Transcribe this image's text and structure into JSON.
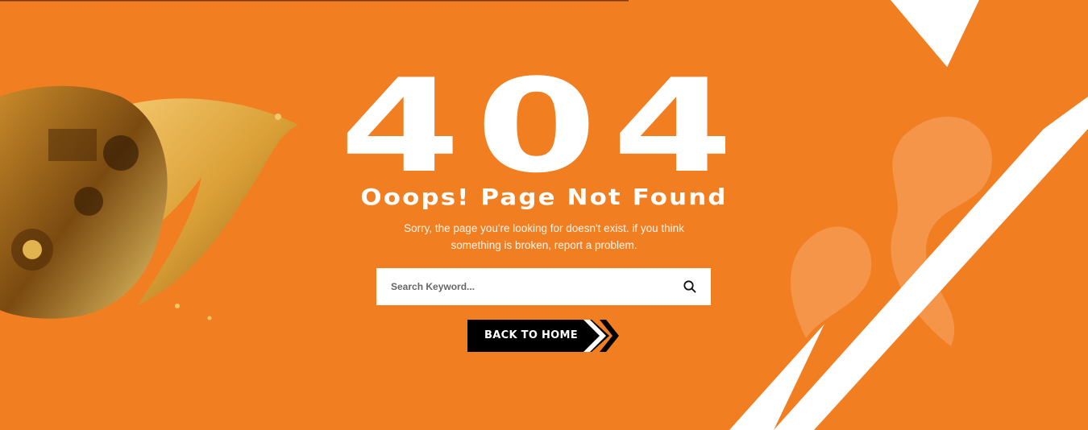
{
  "colors": {
    "accent": "#f27e22",
    "white": "#ffffff",
    "button": "#000000"
  },
  "error": {
    "code": "404",
    "title": "Ooops! Page Not Found",
    "description": "Sorry, the page you're looking for doesn't exist. if you think something is broken, report a problem."
  },
  "search": {
    "placeholder": "Search Keyword...",
    "value": "",
    "icon": "search-icon"
  },
  "home_button": {
    "label": "BACK TO HOME",
    "icon": "double-chevron-right-icon"
  },
  "scroll_top": {
    "icon": "scroll-top-icon"
  }
}
